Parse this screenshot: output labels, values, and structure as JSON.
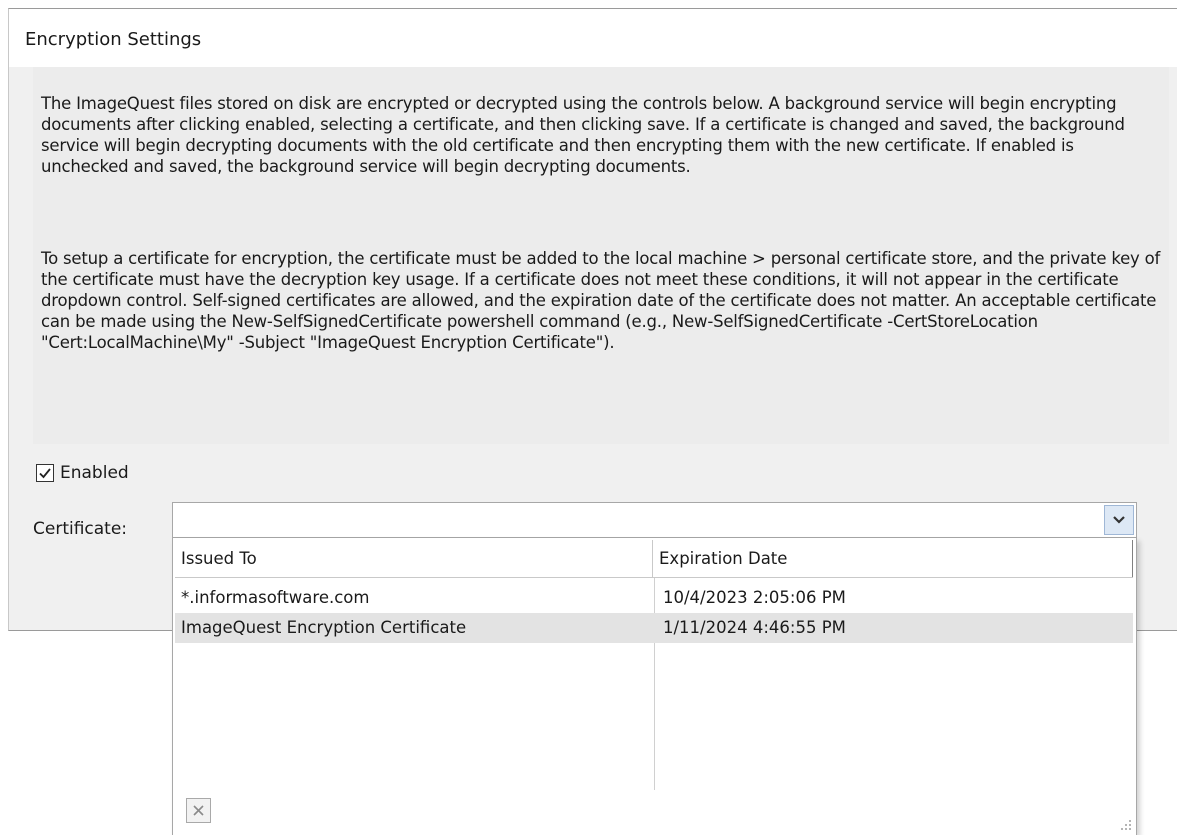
{
  "dialog": {
    "title": "Encryption Settings"
  },
  "description": {
    "paragraph1": "The ImageQuest files stored on disk are encrypted or decrypted using the controls below. A background service will begin encrypting documents after clicking enabled, selecting a certificate, and then clicking save. If a certificate is changed and saved, the background service will begin decrypting documents with the old certificate and then encrypting them with the new certificate. If enabled is unchecked and saved, the background service will begin decrypting documents.",
    "paragraph2": "To setup a certificate for encryption, the certificate must be added to the local machine > personal certificate store, and the private key of the certificate must have the decryption key usage. If a certificate does not meet these conditions, it will not appear in the certificate dropdown control. Self-signed certificates are allowed, and the expiration date of the certificate does not matter. An acceptable certificate can be made using the New-SelfSignedCertificate powershell command (e.g., New-SelfSignedCertificate -CertStoreLocation \"Cert:LocalMachine\\My\" -Subject \"ImageQuest Encryption Certificate\")."
  },
  "enabled": {
    "label": "Enabled",
    "checked": true
  },
  "certificate": {
    "label": "Certificate:",
    "value": "",
    "dropdown_icon": "chevron-down-icon",
    "columns": [
      "Issued To",
      "Expiration Date"
    ],
    "rows": [
      {
        "issued_to": "*.informasoftware.com",
        "expiration": "10/4/2023 2:05:06 PM"
      },
      {
        "issued_to": "ImageQuest Encryption Certificate",
        "expiration": "1/11/2024 4:46:55 PM"
      }
    ],
    "highlighted_row": 1,
    "clear_icon": "close-icon"
  },
  "colors": {
    "panel_background": "#f0f0f0",
    "description_background": "#ececec",
    "highlight_row": "#e3e3e3",
    "combo_button": "#dde8f5"
  }
}
